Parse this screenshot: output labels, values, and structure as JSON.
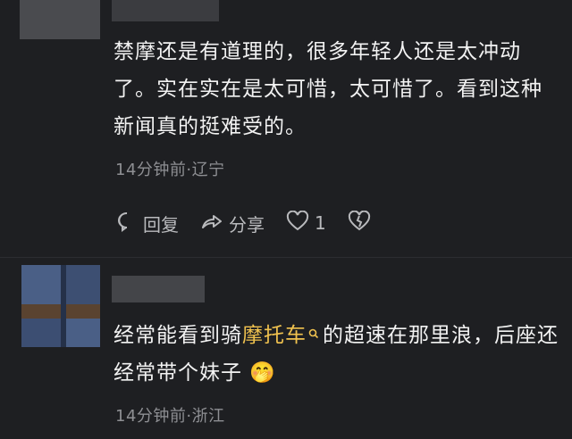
{
  "comment1": {
    "text": "禁摩还是有道理的，很多年轻人还是太冲动了。实在实在是太可惜，太可惜了。看到这种新闻真的挺难受的。",
    "meta": "14分钟前·辽宁",
    "reply_label": "回复",
    "share_label": "分享",
    "like_count": "1"
  },
  "comment2": {
    "text_before": "经常能看到骑",
    "highlight": "摩托车",
    "text_after": "的超速在那里浪，后座还经常带个妹子",
    "emoji": "🤭",
    "meta": "14分钟前·浙江"
  },
  "colors": {
    "background": "#1e1f22",
    "highlight": "#f0c24f",
    "meta": "#8e8f93"
  }
}
